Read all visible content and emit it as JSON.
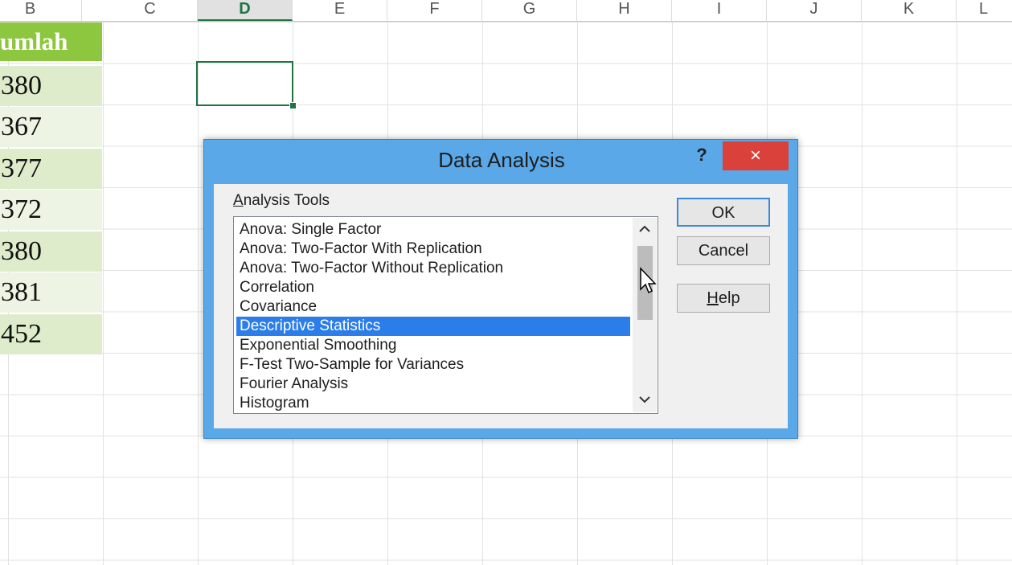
{
  "columns": [
    {
      "label": "B",
      "selected": false
    },
    {
      "label": "C",
      "selected": false
    },
    {
      "label": "D",
      "selected": true
    },
    {
      "label": "E",
      "selected": false
    },
    {
      "label": "F",
      "selected": false
    },
    {
      "label": "G",
      "selected": false
    },
    {
      "label": "H",
      "selected": false
    },
    {
      "label": "I",
      "selected": false
    },
    {
      "label": "J",
      "selected": false
    },
    {
      "label": "K",
      "selected": false
    },
    {
      "label": "L",
      "selected": false
    }
  ],
  "sheet": {
    "header": "umlah",
    "values": [
      "380",
      "367",
      "377",
      "372",
      "380",
      "381",
      "452"
    ],
    "colors": {
      "header_bg": "#8dc63f",
      "selection": "#217346"
    }
  },
  "dialog": {
    "title": "Data Analysis",
    "help_icon": "?",
    "close_icon": "×",
    "group_label_prefix": "A",
    "group_label_rest": "nalysis Tools",
    "items": [
      "Anova: Single Factor",
      "Anova: Two-Factor With Replication",
      "Anova: Two-Factor Without Replication",
      "Correlation",
      "Covariance",
      "Descriptive Statistics",
      "Exponential Smoothing",
      "F-Test Two-Sample for Variances",
      "Fourier Analysis",
      "Histogram"
    ],
    "selected_item": "Descriptive Statistics",
    "buttons": {
      "ok": "OK",
      "cancel": "Cancel",
      "help_prefix": "H",
      "help_rest": "elp"
    },
    "colors": {
      "title_bar": "#5aa8e8",
      "close": "#d9413a",
      "selection": "#2b7de9"
    }
  }
}
